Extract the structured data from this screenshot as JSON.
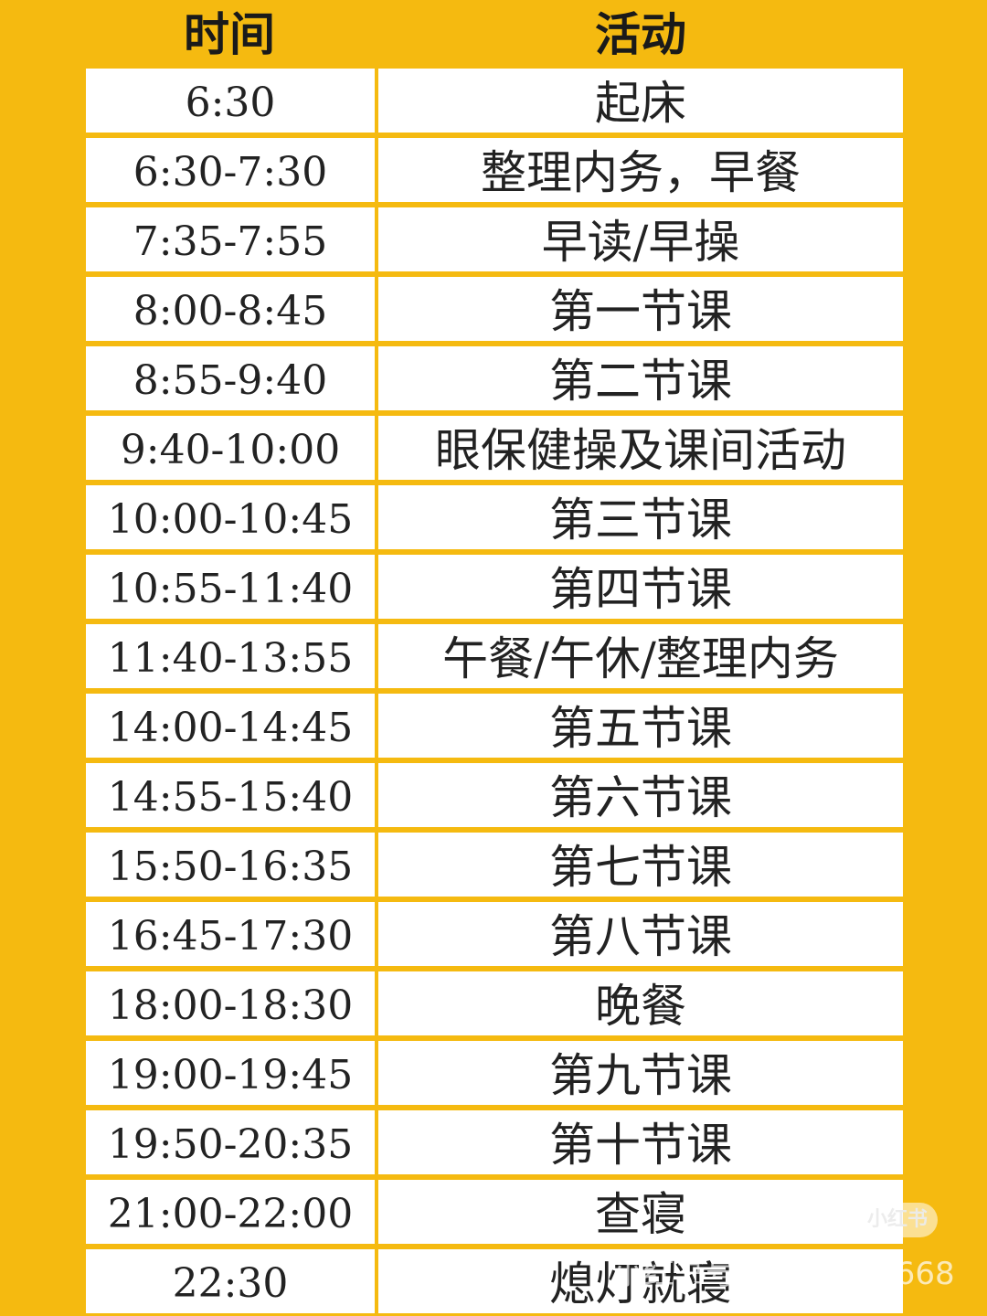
{
  "header": {
    "time": "时间",
    "activity": "活动"
  },
  "rows": [
    {
      "time": "6:30",
      "activity": "起床"
    },
    {
      "time": "6:30-7:30",
      "activity": "整理内务，早餐"
    },
    {
      "time": "7:35-7:55",
      "activity": "早读/早操"
    },
    {
      "time": "8:00-8:45",
      "activity": "第一节课"
    },
    {
      "time": "8:55-9:40",
      "activity": "第二节课"
    },
    {
      "time": "9:40-10:00",
      "activity": "眼保健操及课间活动"
    },
    {
      "time": "10:00-10:45",
      "activity": "第三节课"
    },
    {
      "time": "10:55-11:40",
      "activity": "第四节课"
    },
    {
      "time": "11:40-13:55",
      "activity": "午餐/午休/整理内务"
    },
    {
      "time": "14:00-14:45",
      "activity": "第五节课"
    },
    {
      "time": "14:55-15:40",
      "activity": "第六节课"
    },
    {
      "time": "15:50-16:35",
      "activity": "第七节课"
    },
    {
      "time": "16:45-17:30",
      "activity": "第八节课"
    },
    {
      "time": "18:00-18:30",
      "activity": "晚餐"
    },
    {
      "time": "19:00-19:45",
      "activity": "第九节课"
    },
    {
      "time": "19:50-20:35",
      "activity": "第十节课"
    },
    {
      "time": "21:00-22:00",
      "activity": "查寝"
    },
    {
      "time": "22:30",
      "activity": "熄灯就寝"
    }
  ],
  "watermark": {
    "badge": "小红书",
    "id_text": "小红书号: 4748786668"
  },
  "colors": {
    "background": "#F5BA10",
    "cell": "#FFFFFF",
    "text": "#222222"
  }
}
